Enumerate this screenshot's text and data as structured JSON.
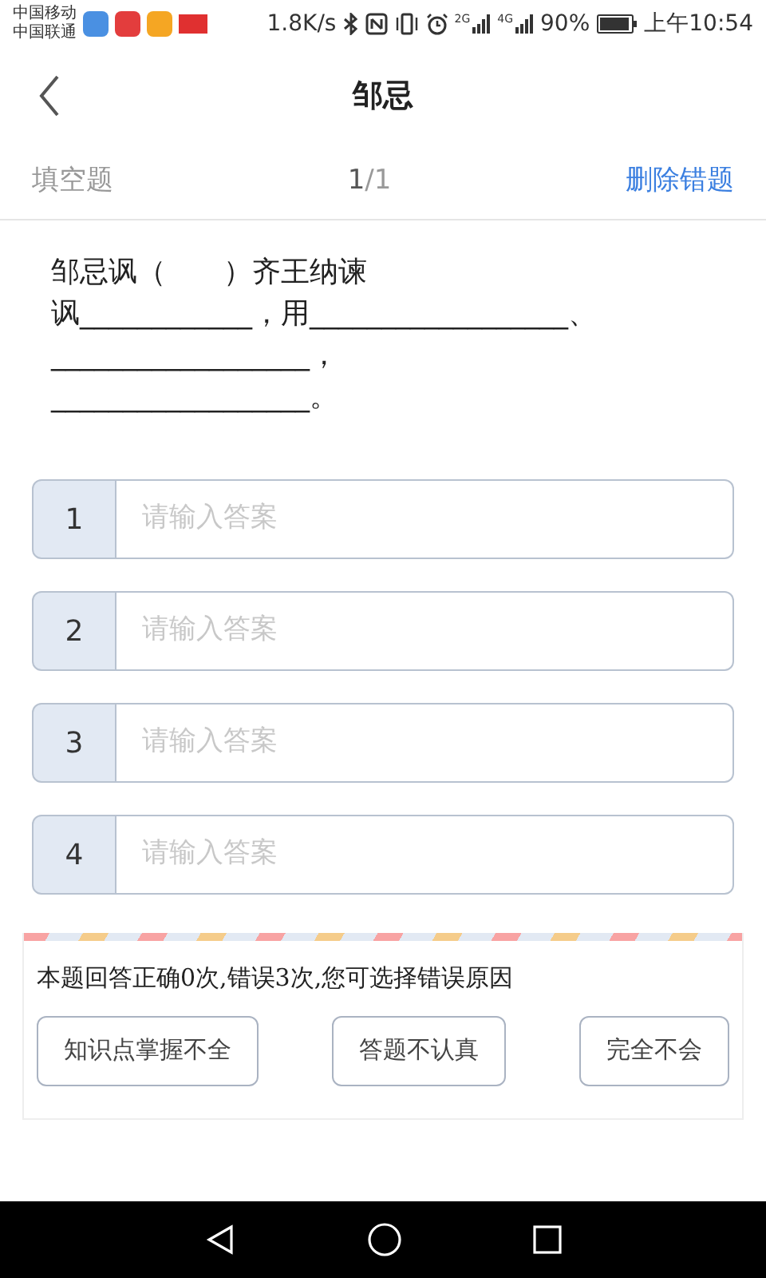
{
  "status_bar": {
    "carriers": [
      "中国移动",
      "中国联通"
    ],
    "speed": "1.8K/s",
    "signal_labels": [
      "2G",
      "4G"
    ],
    "battery": "90%",
    "time": "上午10:54"
  },
  "header": {
    "title": "邹忌"
  },
  "question_bar": {
    "type": "填空题",
    "current": "1",
    "total": "/1",
    "action": "删除错题"
  },
  "question": {
    "lines": [
      "邹忌讽（　　）齐王纳谏",
      "讽____________，用__________________、",
      "__________________，",
      "__________________。"
    ]
  },
  "answers": [
    {
      "number": "1",
      "placeholder": "请输入答案"
    },
    {
      "number": "2",
      "placeholder": "请输入答案"
    },
    {
      "number": "3",
      "placeholder": "请输入答案"
    },
    {
      "number": "4",
      "placeholder": "请输入答案"
    }
  ],
  "error_panel": {
    "message": "本题回答正确0次,错误3次,您可选择错误原因",
    "reasons": [
      "知识点掌握不全",
      "答题不认真",
      "完全不会"
    ]
  }
}
